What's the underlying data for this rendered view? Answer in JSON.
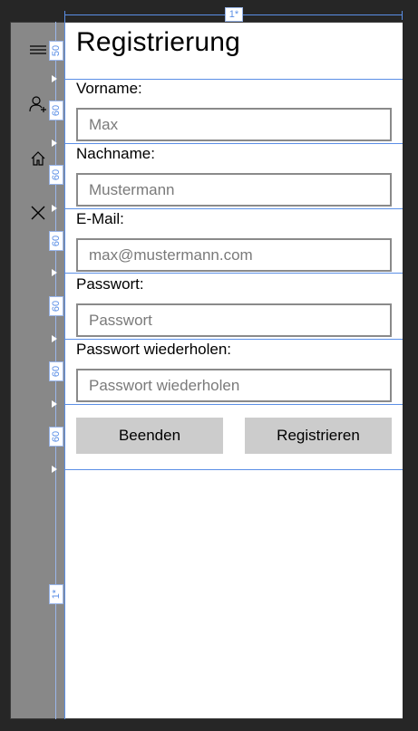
{
  "page": {
    "title": "Registrierung"
  },
  "nav": {
    "items": [
      {
        "icon": "hamburger-menu-icon"
      },
      {
        "icon": "add-user-icon"
      },
      {
        "icon": "home-icon"
      },
      {
        "icon": "close-icon"
      }
    ]
  },
  "form": {
    "firstname": {
      "label": "Vorname:",
      "placeholder": "Max"
    },
    "lastname": {
      "label": "Nachname:",
      "placeholder": "Mustermann"
    },
    "email": {
      "label": "E-Mail:",
      "placeholder": "max@mustermann.com"
    },
    "password": {
      "label": "Passwort:",
      "placeholder": "Passwort"
    },
    "password_repeat": {
      "label": "Passwort wiederholen:",
      "placeholder": "Passwort wiederholen"
    }
  },
  "buttons": {
    "cancel": "Beenden",
    "register": "Registrieren"
  },
  "designer": {
    "column_width": "1*",
    "row_heights": [
      "50",
      "60",
      "60",
      "60",
      "60",
      "60",
      "60",
      "1*"
    ]
  },
  "colors": {
    "nav_background": "#888888",
    "button_background": "#cccccc",
    "guide_line": "#5b8fe6"
  }
}
